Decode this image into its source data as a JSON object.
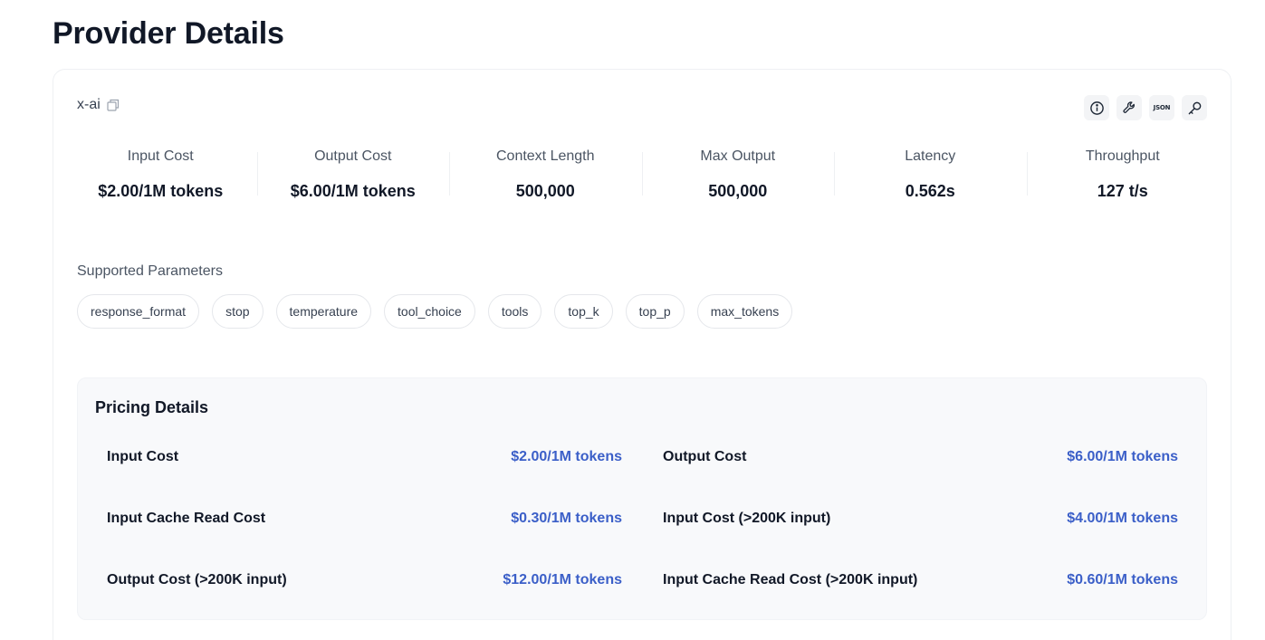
{
  "page": {
    "title": "Provider Details"
  },
  "provider": {
    "name": "x-ai"
  },
  "actions": [
    {
      "icon": "info-icon"
    },
    {
      "icon": "wrench-icon"
    },
    {
      "icon": "json-icon",
      "label": "JSON"
    },
    {
      "icon": "key-icon"
    }
  ],
  "stats": [
    {
      "label": "Input Cost",
      "value": "$2.00/1M tokens"
    },
    {
      "label": "Output Cost",
      "value": "$6.00/1M tokens"
    },
    {
      "label": "Context Length",
      "value": "500,000"
    },
    {
      "label": "Max Output",
      "value": "500,000"
    },
    {
      "label": "Latency",
      "value": "0.562s"
    },
    {
      "label": "Throughput",
      "value": "127 t/s"
    }
  ],
  "parameters": {
    "label": "Supported Parameters",
    "items": [
      "response_format",
      "stop",
      "temperature",
      "tool_choice",
      "tools",
      "top_k",
      "top_p",
      "max_tokens"
    ]
  },
  "pricing": {
    "title": "Pricing Details",
    "rows": [
      {
        "label": "Input Cost",
        "value": "$2.00/1M tokens"
      },
      {
        "label": "Output Cost",
        "value": "$6.00/1M tokens"
      },
      {
        "label": "Input Cache Read Cost",
        "value": "$0.30/1M tokens"
      },
      {
        "label": "Input Cost (>200K input)",
        "value": "$4.00/1M tokens"
      },
      {
        "label": "Output Cost (>200K input)",
        "value": "$12.00/1M tokens"
      },
      {
        "label": "Input Cache Read Cost (>200K input)",
        "value": "$0.60/1M tokens"
      }
    ]
  },
  "colors": {
    "accent": "#3b5fc8",
    "card_border": "#eef0f3",
    "pricing_bg": "#f8f9fb"
  }
}
